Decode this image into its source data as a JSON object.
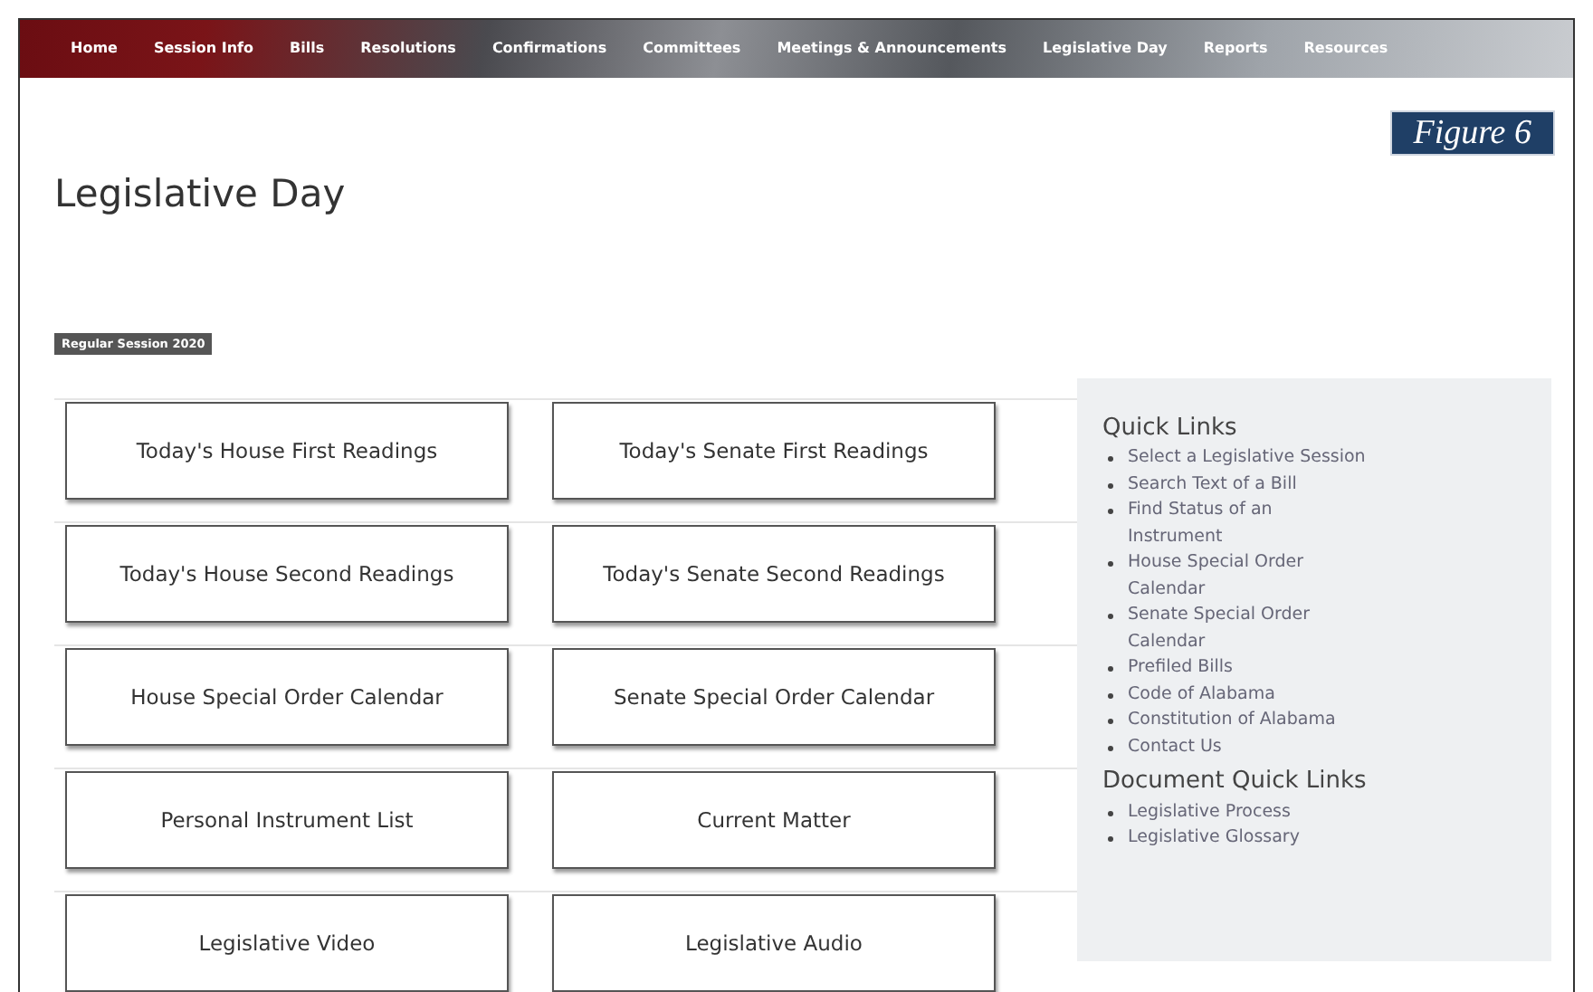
{
  "nav": [
    "Home",
    "Session Info",
    "Bills",
    "Resolutions",
    "Confirmations",
    "Committees",
    "Meetings & Announcements",
    "Legislative Day",
    "Reports",
    "Resources"
  ],
  "figure_label": "Figure 6",
  "title": "Legislative Day",
  "session_badge": "Regular Session 2020",
  "tiles": [
    [
      "Today's House First Readings",
      "Today's Senate First Readings"
    ],
    [
      "Today's House Second Readings",
      "Today's Senate Second Readings"
    ],
    [
      "House Special Order Calendar",
      "Senate Special Order Calendar"
    ],
    [
      "Personal Instrument List",
      "Current Matter"
    ],
    [
      "Legislative Video",
      "Legislative Audio"
    ]
  ],
  "sidebar": [
    {
      "heading": "Quick Links",
      "links": [
        "Select a Legislative Session",
        "Search Text of a Bill",
        "Find Status of an Instrument",
        "House Special Order Calendar",
        "Senate Special Order Calendar",
        "Prefiled Bills",
        "Code of Alabama",
        "Constitution of Alabama",
        "Contact Us"
      ]
    },
    {
      "heading": "Document Quick Links",
      "links": [
        "Legislative Process",
        "Legislative Glossary"
      ]
    }
  ]
}
